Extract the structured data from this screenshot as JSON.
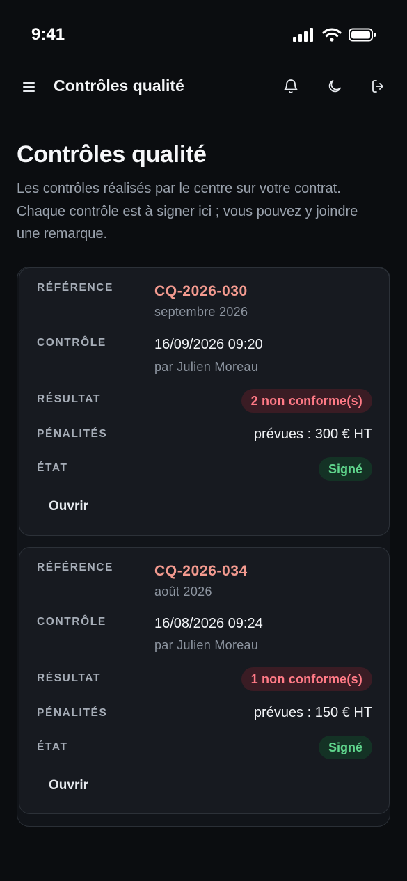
{
  "status_bar": {
    "time": "9:41"
  },
  "header": {
    "title": "Contrôles qualité",
    "icons": [
      "menu-icon",
      "bell-icon",
      "moon-icon",
      "logout-icon"
    ]
  },
  "page": {
    "title": "Contrôles qualité",
    "description": "Les contrôles réalisés par le centre sur votre contrat. Chaque contrôle est à signer ici ; vous pouvez y joindre une remarque."
  },
  "labels": {
    "reference": "RÉFÉRENCE",
    "controle": "CONTRÔLE",
    "resultat": "RÉSULTAT",
    "penalites": "PÉNALITÉS",
    "etat": "ÉTAT"
  },
  "controls": [
    {
      "reference": "CQ-2026-030",
      "period": "septembre 2026",
      "datetime": "16/09/2026 09:20",
      "by": "par Julien Moreau",
      "result": "2 non conforme(s)",
      "penalties": "prévues : 300 € HT",
      "state": "Signé",
      "open_label": "Ouvrir"
    },
    {
      "reference": "CQ-2026-034",
      "period": "août 2026",
      "datetime": "16/08/2026 09:24",
      "by": "par Julien Moreau",
      "result": "1 non conforme(s)",
      "penalties": "prévues : 150 € HT",
      "state": "Signé",
      "open_label": "Ouvrir"
    }
  ],
  "colors": {
    "background": "#0b0d10",
    "reference_accent": "#f39a8f",
    "badge_danger": "#ff7a86",
    "badge_success": "#5fd58c"
  }
}
